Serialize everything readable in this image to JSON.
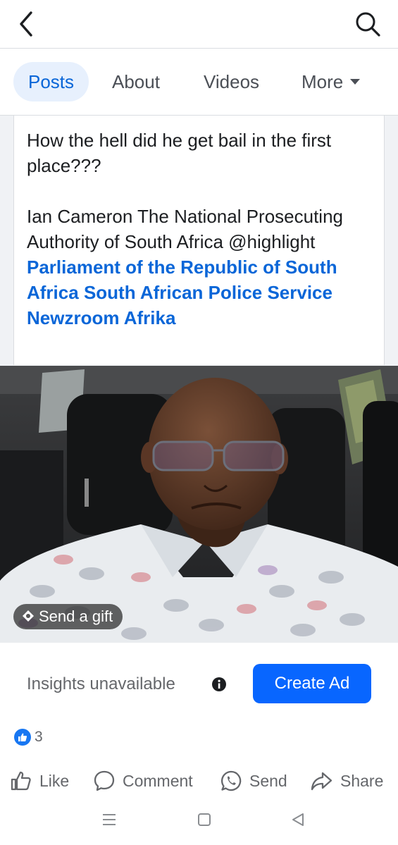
{
  "header": {
    "back_icon": "chevron-left-icon",
    "search_icon": "search-icon"
  },
  "tabs": [
    {
      "label": "Posts",
      "active": true
    },
    {
      "label": "About"
    },
    {
      "label": "Videos"
    },
    {
      "label": "More"
    }
  ],
  "post": {
    "line1": "How the hell did he get bail in the first place???",
    "line2_plain": "Ian Cameron The National Prosecuting Authority of South Africa @highlight",
    "links": [
      "Parliament of the Republic of South Africa",
      "South African Police Service",
      "Newzroom Afrika"
    ],
    "gift_label": "Send a gift"
  },
  "insights": {
    "label": "Insights unavailable",
    "button": "Create Ad"
  },
  "reactions": {
    "count": "3"
  },
  "actions": {
    "like": "Like",
    "comment": "Comment",
    "send": "Send",
    "share": "Share"
  },
  "colors": {
    "accent": "#0866ff",
    "link": "#0a66d8",
    "muted": "#65676b"
  }
}
